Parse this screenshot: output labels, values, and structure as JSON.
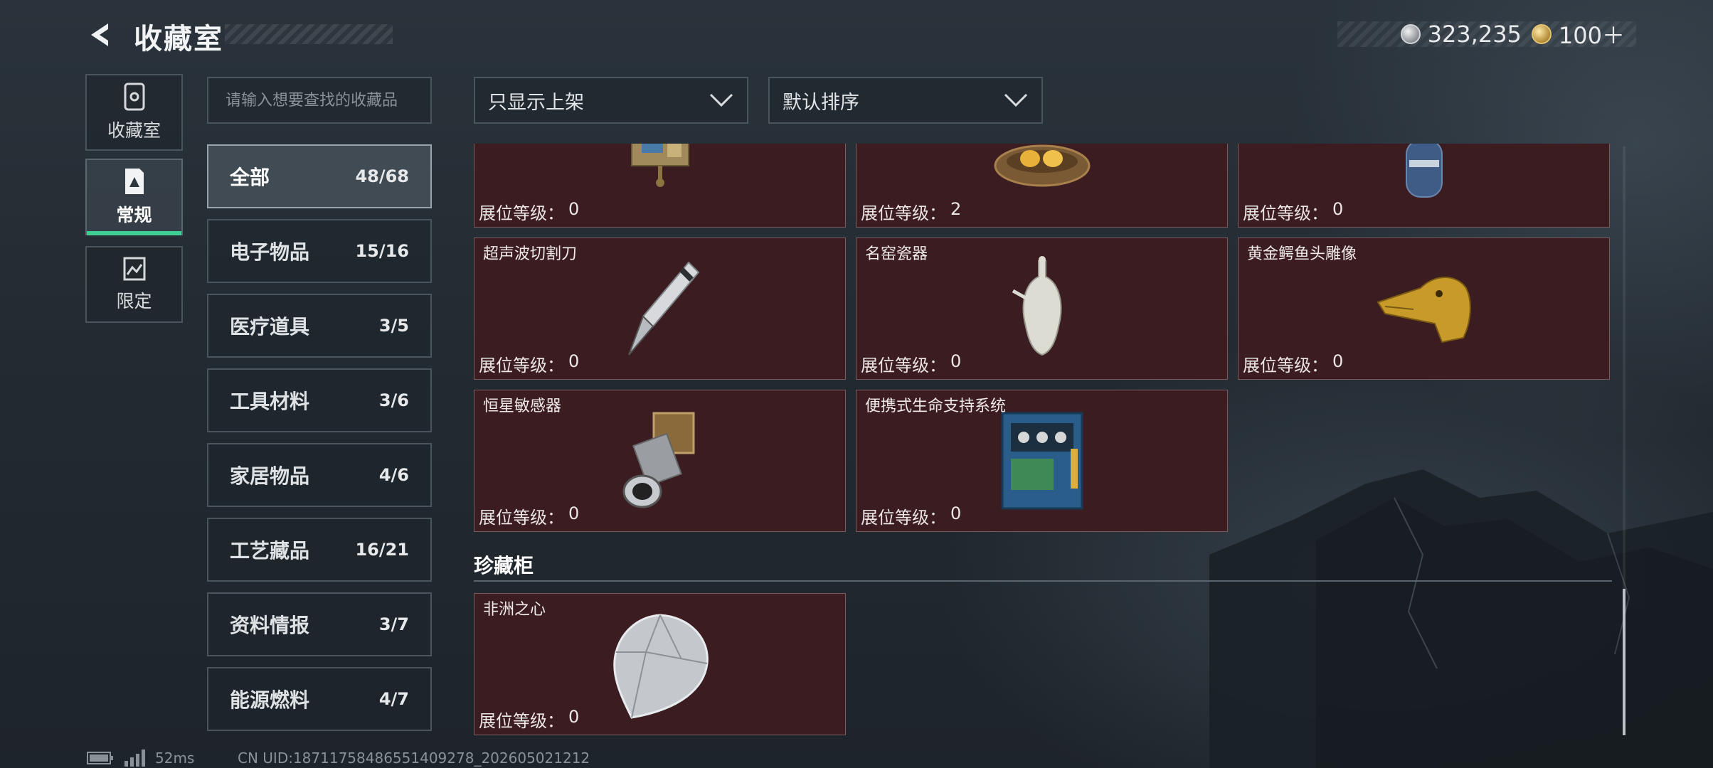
{
  "header": {
    "title": "收藏室",
    "currency_silver": "323,235",
    "currency_gold": "100＋"
  },
  "left_tabs": [
    {
      "label": "收藏室"
    },
    {
      "label": "常规"
    },
    {
      "label": "限定"
    }
  ],
  "search": {
    "placeholder": "请输入想要查找的收藏品"
  },
  "filters": {
    "shelf_filter": "只显示上架",
    "sort": "默认排序"
  },
  "categories": [
    {
      "name": "全部",
      "count": "48/68"
    },
    {
      "name": "电子物品",
      "count": "15/16"
    },
    {
      "name": "医疗道具",
      "count": "3/5"
    },
    {
      "name": "工具材料",
      "count": "3/6"
    },
    {
      "name": "家居物品",
      "count": "4/6"
    },
    {
      "name": "工艺藏品",
      "count": "16/21"
    },
    {
      "name": "资料情报",
      "count": "3/7"
    },
    {
      "name": "能源燃料",
      "count": "4/7"
    }
  ],
  "level_label": "展位等级：",
  "items": [
    {
      "name": "",
      "level": "0"
    },
    {
      "name": "",
      "level": "2"
    },
    {
      "name": "",
      "level": "0"
    },
    {
      "name": "超声波切割刀",
      "level": "0"
    },
    {
      "name": "名窑瓷器",
      "level": "0"
    },
    {
      "name": "黄金鳄鱼头雕像",
      "level": "0"
    },
    {
      "name": "恒星敏感器",
      "level": "0"
    },
    {
      "name": "便携式生命支持系统",
      "level": "0"
    }
  ],
  "section": {
    "title": "珍藏柜",
    "items": [
      {
        "name": "非洲之心",
        "level": "0"
      }
    ]
  },
  "status": {
    "ping": "52ms",
    "uid": "CN UID:18711758486551409278_202605021212"
  }
}
